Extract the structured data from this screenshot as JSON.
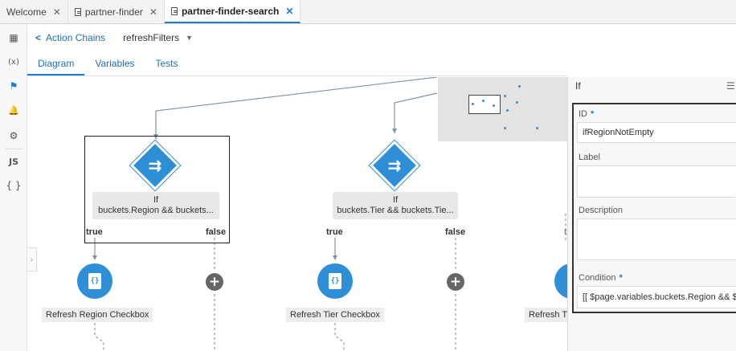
{
  "tabs": [
    {
      "label": "Welcome",
      "close": "✕"
    },
    {
      "label": "partner-finder",
      "close": "✕"
    },
    {
      "label": "partner-finder-search",
      "close": "✕"
    }
  ],
  "rail": [
    {
      "icon": "components-icon",
      "glyph": "▦"
    },
    {
      "icon": "variables-icon",
      "glyph": "(x)"
    },
    {
      "icon": "action-chains-icon",
      "glyph": "⚑"
    },
    {
      "icon": "events-icon",
      "glyph": "🔔"
    },
    {
      "icon": "settings-icon",
      "glyph": "⚙"
    },
    {
      "icon": "javascript-icon",
      "glyph": "JS"
    },
    {
      "icon": "json-icon",
      "glyph": "{ }"
    }
  ],
  "header": {
    "back_label": "Action Chains",
    "chain_name": "refreshFilters"
  },
  "subtabs": [
    "Diagram",
    "Variables",
    "Tests"
  ],
  "diagram": {
    "if1": {
      "title": "If",
      "expr": "buckets.Region && buckets..."
    },
    "if2": {
      "title": "If",
      "expr": "buckets.Tier && buckets.Tie..."
    },
    "branches": {
      "true_label": "true",
      "false_label": "false",
      "partial_label": "t"
    },
    "action1": {
      "label": "Refresh Region Checkbox",
      "glyph": "{}"
    },
    "action2": {
      "label": "Refresh Tier Checkbox",
      "glyph": "{}"
    },
    "action3": {
      "label": "Refresh Ty"
    }
  },
  "panel": {
    "title": "If",
    "menu_glyph": "☰",
    "id_label": "ID",
    "id_value": "ifRegionNotEmpty",
    "label_label": "Label",
    "description_label": "Description",
    "condition_label": "Condition",
    "condition_value": "[[ $page.variables.buckets.Region && $"
  },
  "colors": {
    "accent": "#1f7bd1",
    "node": "#2e8fd6"
  }
}
